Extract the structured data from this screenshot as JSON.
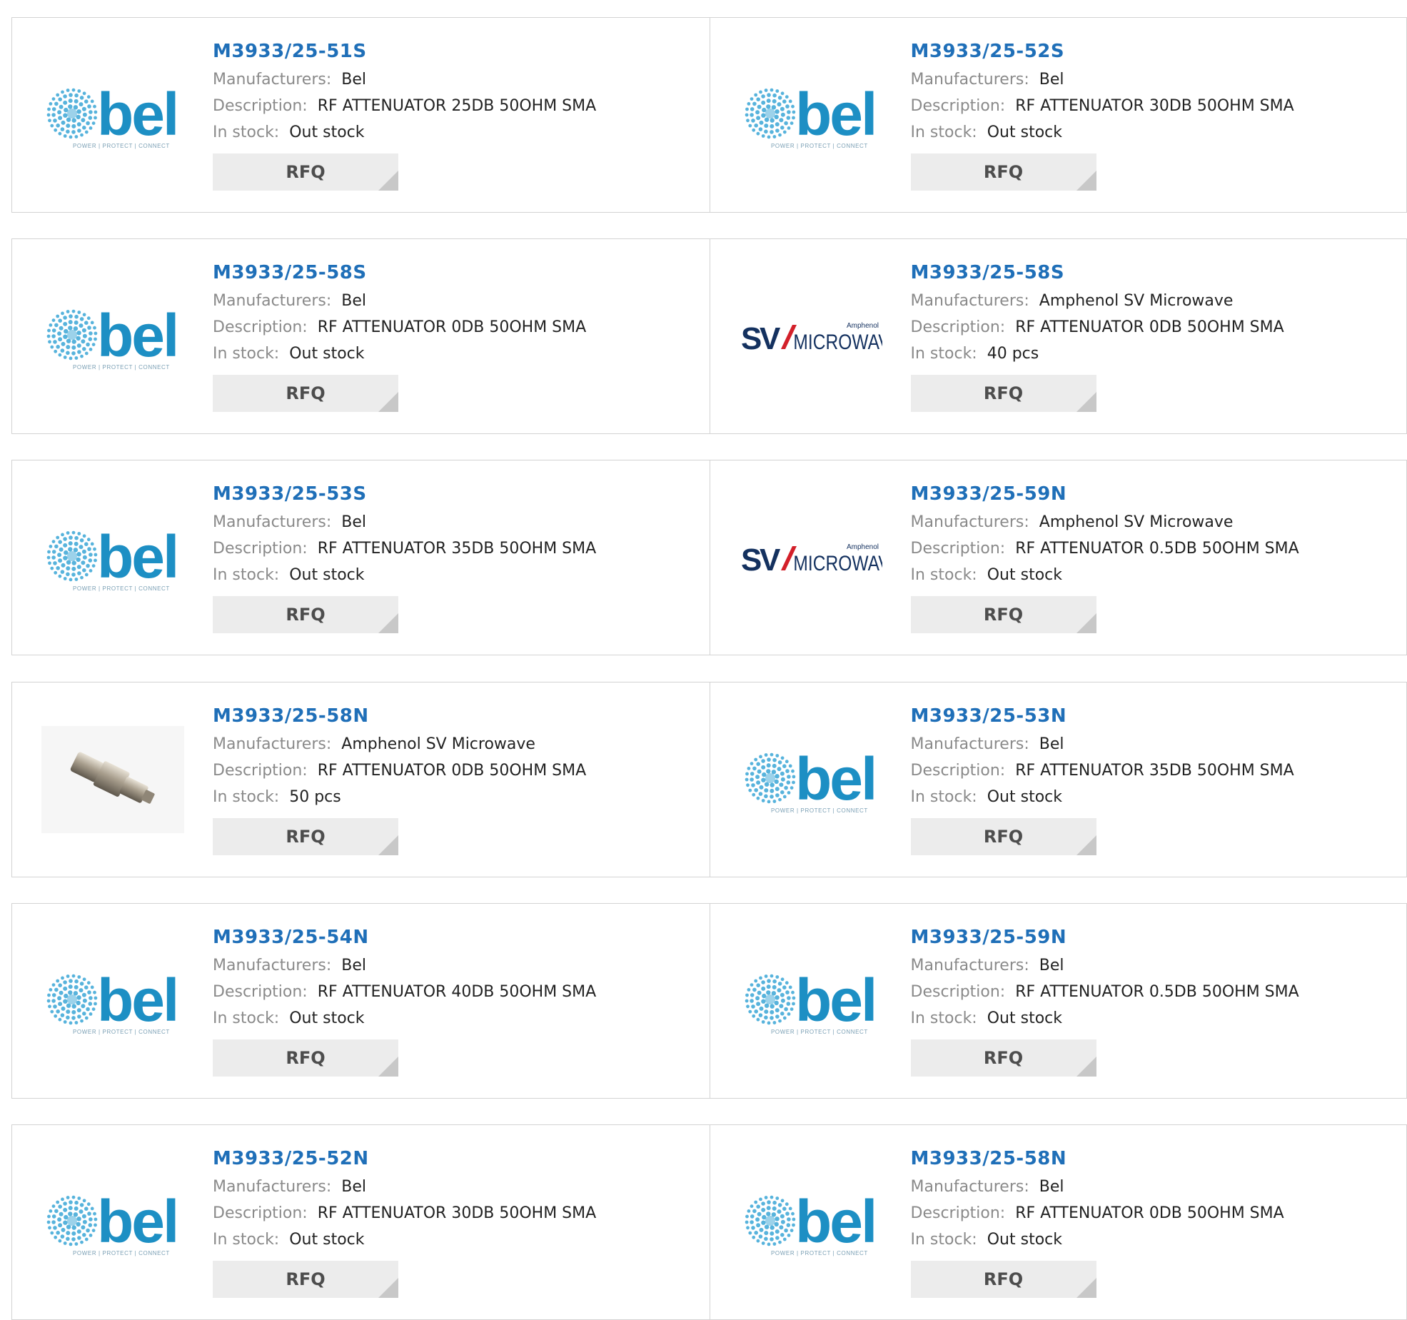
{
  "labels": {
    "manufacturers": "Manufacturers:",
    "description": "Description:",
    "in_stock": "In stock:",
    "rfq": "RFQ"
  },
  "logos": {
    "bel": {
      "wordmark": "bel",
      "tagline": "POWER | PROTECT | CONNECT",
      "color": "#1d8fc4",
      "dot_color": "#3aa6d6"
    },
    "sv": {
      "wordmark_a": "SV",
      "wordmark_b": "MICROWAVE",
      "tagline": "Amphenol",
      "navy": "#14315f",
      "red": "#d3202a"
    }
  },
  "colors": {
    "part_number": "#1f6fb8",
    "label": "#8a8a8a",
    "value": "#222222",
    "rfq_bg": "#ececec",
    "border": "#d3d3d3"
  },
  "products": [
    {
      "part_number": "M3933/25-51S",
      "logo": "bel-logo",
      "manufacturer": "Bel",
      "description": "RF ATTENUATOR 25DB 50OHM SMA",
      "stock": "Out stock"
    },
    {
      "part_number": "M3933/25-52S",
      "logo": "bel-logo",
      "manufacturer": "Bel",
      "description": "RF ATTENUATOR 30DB 50OHM SMA",
      "stock": "Out stock"
    },
    {
      "part_number": "M3933/25-58S",
      "logo": "bel-logo",
      "manufacturer": "Bel",
      "description": "RF ATTENUATOR 0DB 50OHM SMA",
      "stock": "Out stock"
    },
    {
      "part_number": "M3933/25-58S",
      "logo": "sv-microwave-logo",
      "manufacturer": "Amphenol SV Microwave",
      "description": "RF ATTENUATOR 0DB 50OHM SMA",
      "stock": "40 pcs"
    },
    {
      "part_number": "M3933/25-53S",
      "logo": "bel-logo",
      "manufacturer": "Bel",
      "description": "RF ATTENUATOR 35DB 50OHM SMA",
      "stock": "Out stock"
    },
    {
      "part_number": "M3933/25-59N",
      "logo": "sv-microwave-logo",
      "manufacturer": "Amphenol SV Microwave",
      "description": "RF ATTENUATOR 0.5DB 50OHM SMA",
      "stock": "Out stock"
    },
    {
      "part_number": "M3933/25-58N",
      "logo": "product-photo",
      "manufacturer": "Amphenol SV Microwave",
      "description": "RF ATTENUATOR 0DB 50OHM SMA",
      "stock": "50 pcs"
    },
    {
      "part_number": "M3933/25-53N",
      "logo": "bel-logo",
      "manufacturer": "Bel",
      "description": "RF ATTENUATOR 35DB 50OHM SMA",
      "stock": "Out stock"
    },
    {
      "part_number": "M3933/25-54N",
      "logo": "bel-logo",
      "manufacturer": "Bel",
      "description": "RF ATTENUATOR 40DB 50OHM SMA",
      "stock": "Out stock"
    },
    {
      "part_number": "M3933/25-59N",
      "logo": "bel-logo",
      "manufacturer": "Bel",
      "description": "RF ATTENUATOR 0.5DB 50OHM SMA",
      "stock": "Out stock"
    },
    {
      "part_number": "M3933/25-52N",
      "logo": "bel-logo",
      "manufacturer": "Bel",
      "description": "RF ATTENUATOR 30DB 50OHM SMA",
      "stock": "Out stock"
    },
    {
      "part_number": "M3933/25-58N",
      "logo": "bel-logo",
      "manufacturer": "Bel",
      "description": "RF ATTENUATOR 0DB 50OHM SMA",
      "stock": "Out stock"
    }
  ]
}
